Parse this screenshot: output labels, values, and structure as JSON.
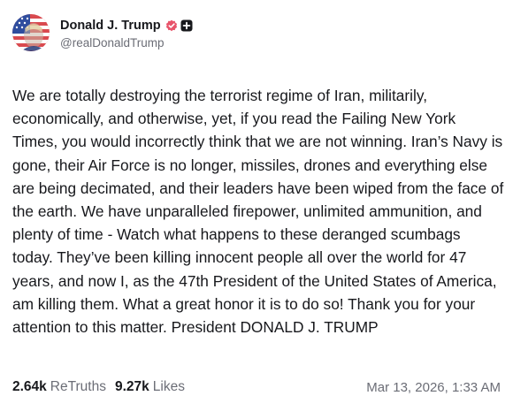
{
  "post": {
    "author": {
      "display_name": "Donald J. Trump",
      "handle": "@realDonaldTrump",
      "avatar_icon": "avatar-flag-icon",
      "badges": [
        "verified-badge-icon",
        "plus-badge-icon"
      ]
    },
    "body": "We are totally destroying the terrorist regime of Iran, militarily, economically, and otherwise, yet, if you read the Failing New York Times, you would incorrectly think that we are not winning. Iran’s Navy is gone, their Air Force is no longer, missiles, drones and everything else are being decimated, and their leaders have been wiped from the face of the earth. We have unparalleled firepower, unlimited ammunition, and plenty of time - Watch what happens to these deranged scumbags today. They’ve been killing innocent people all over the world for 47 years, and now I, as the 47th President of the United States of America, am killing them. What a great honor it is to do so! Thank you for your attention to this matter. President DONALD J. TRUMP",
    "stats": {
      "retruths_count": "2.64k",
      "retruths_label": "ReTruths",
      "likes_count": "9.27k",
      "likes_label": "Likes"
    },
    "timestamp": "Mar 13, 2026, 1:33 AM"
  },
  "colors": {
    "text_primary": "#17181c",
    "text_secondary": "#6b6d76",
    "verified_badge": "#e8546a",
    "plus_badge": "#17181c"
  }
}
